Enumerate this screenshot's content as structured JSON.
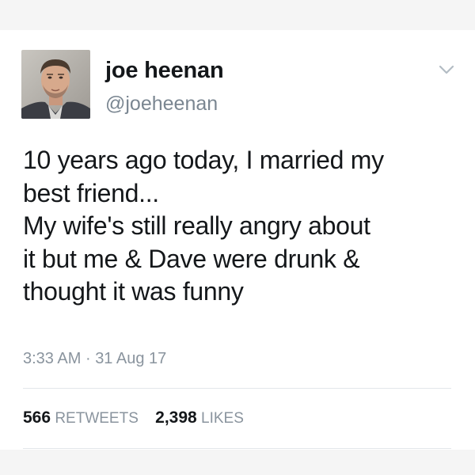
{
  "tweet": {
    "display_name": "joe heenan",
    "handle": "@joeheenan",
    "text_lines": [
      "10 years ago today, I married my",
      "best friend...",
      "My wife's still really angry about",
      "it but me & Dave were drunk &",
      "thought it was funny"
    ],
    "time": "3:33 AM",
    "separator": "·",
    "date": "31 Aug 17",
    "retweets_count": "566",
    "retweets_label": "RETWEETS",
    "likes_count": "2,398",
    "likes_label": "LIKES"
  },
  "icons": {
    "caret": "chevron-down-icon",
    "avatar": "avatar-photo"
  },
  "colors": {
    "text_primary": "#14171a",
    "text_secondary": "#8a949e",
    "divider": "#e3e7ea"
  }
}
